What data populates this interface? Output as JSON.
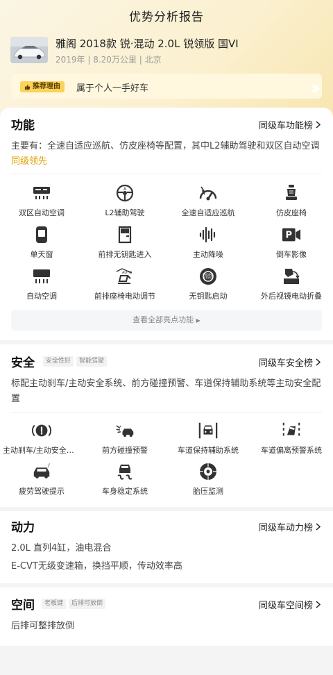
{
  "header": {
    "title": "优势分析报告",
    "car_name": "雅阁 2018款 锐·混动 2.0L 锐领版 国VI",
    "car_meta": "2019年 | 8.20万公里 | 北京",
    "reason_tag": "推荐理由",
    "reason_text": "属于个人一手好车"
  },
  "function": {
    "title": "功能",
    "link": "同级车功能榜",
    "desc_main": "主要有：全速自适应巡航、仿皮座椅等配置，其中L2辅助驾驶和双区自动空调",
    "desc_highlight": "同级领先",
    "items": [
      {
        "label": "双区自动空调",
        "icon": "dual-zone-ac-icon"
      },
      {
        "label": "L2辅助驾驶",
        "icon": "steering-wheel-icon"
      },
      {
        "label": "全速自适应巡航",
        "icon": "speedometer-icon"
      },
      {
        "label": "仿皮座椅",
        "icon": "seat-icon"
      },
      {
        "label": "单天窗",
        "icon": "sunroof-icon"
      },
      {
        "label": "前排无钥匙进入",
        "icon": "car-door-icon"
      },
      {
        "label": "主动降噪",
        "icon": "sound-wave-icon"
      },
      {
        "label": "倒车影像",
        "icon": "parking-camera-icon"
      },
      {
        "label": "自动空调",
        "icon": "ac-unit-icon"
      },
      {
        "label": "前排座椅电动调节",
        "icon": "auto-seat-icon"
      },
      {
        "label": "无钥匙启动",
        "icon": "keyless-start-icon"
      },
      {
        "label": "外后视镜电动折叠",
        "icon": "mirror-fold-icon"
      }
    ],
    "more_label": "查看全部亮点功能"
  },
  "safety": {
    "title": "安全",
    "tags": [
      "安全性好",
      "智能驾驶"
    ],
    "link": "同级车安全榜",
    "desc": "标配主动刹车/主动安全系统、前方碰撞预警、车道保持辅助系统等主动安全配置",
    "items": [
      {
        "label": "主动刹车/主动安全系统",
        "icon": "active-brake-icon"
      },
      {
        "label": "前方碰撞预警",
        "icon": "collision-warning-icon"
      },
      {
        "label": "车道保持辅助系统",
        "icon": "lane-keep-icon"
      },
      {
        "label": "车道偏离预警系统",
        "icon": "lane-departure-icon"
      },
      {
        "label": "疲劳驾驶提示",
        "icon": "fatigue-alert-icon"
      },
      {
        "label": "车身稳定系统",
        "icon": "stability-control-icon"
      },
      {
        "label": "胎压监测",
        "icon": "tire-pressure-icon"
      }
    ]
  },
  "power": {
    "title": "动力",
    "link": "同级车动力榜",
    "lines": [
      "2.0L 直列4缸，油电混合",
      "E-CVT无级变速箱，换挡平顺，传动效率高"
    ]
  },
  "space": {
    "title": "空间",
    "tags": [
      "老板键",
      "后排可放倒"
    ],
    "link": "同级车空间榜",
    "desc": "后排可整排放倒"
  },
  "colors": {
    "accent": "#e2a200",
    "tag_bg": "#fbd35a",
    "icon": "#333333"
  }
}
